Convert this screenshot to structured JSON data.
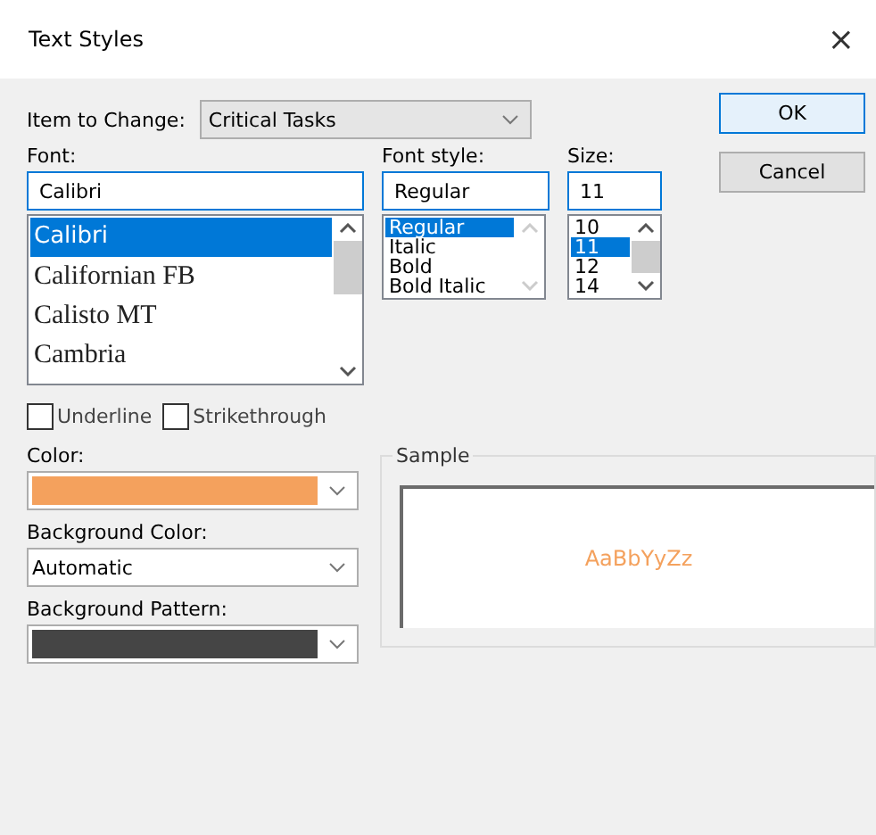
{
  "window": {
    "title": "Text Styles",
    "close": "×"
  },
  "item_to_change": {
    "label": "Item to Change:",
    "value": "Critical Tasks"
  },
  "buttons": [
    {
      "label": "OK",
      "default": true
    },
    {
      "label": "Cancel",
      "default": false
    }
  ],
  "font": {
    "label": "Font:",
    "value": "Calibri",
    "items": [
      {
        "label": "Calibri",
        "kind": "sans",
        "selected": true
      },
      {
        "label": "Californian FB",
        "kind": "serif",
        "selected": false
      },
      {
        "label": "Calisto MT",
        "kind": "serif",
        "selected": false
      },
      {
        "label": "Cambria",
        "kind": "serif",
        "selected": false
      }
    ]
  },
  "font_style": {
    "label": "Font style:",
    "value": "Regular",
    "items": [
      {
        "label": "Regular",
        "selected": true
      },
      {
        "label": "Italic",
        "selected": false
      },
      {
        "label": "Bold",
        "selected": false
      },
      {
        "label": "Bold Italic",
        "selected": false
      }
    ]
  },
  "size": {
    "label": "Size:",
    "value": "11",
    "items": [
      {
        "label": "10",
        "selected": false
      },
      {
        "label": "11",
        "selected": true
      },
      {
        "label": "12",
        "selected": false
      },
      {
        "label": "14",
        "selected": false
      }
    ]
  },
  "effects": [
    {
      "label": "Underline",
      "checked": false
    },
    {
      "label": "Strikethrough",
      "checked": false
    }
  ],
  "color": {
    "label": "Color:",
    "color": "#f4a15d"
  },
  "background_color": {
    "label": "Background Color:",
    "value": "Automatic"
  },
  "background_pattern": {
    "label": "Background Pattern:",
    "color": "#454545"
  },
  "sample": {
    "label": "Sample",
    "text": "AaBbYyZz"
  }
}
